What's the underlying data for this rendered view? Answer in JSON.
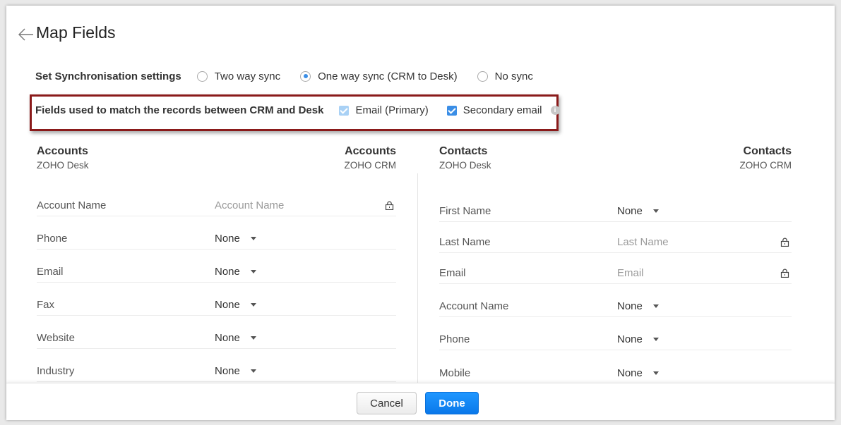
{
  "dialog": {
    "title": "Map Fields"
  },
  "sync": {
    "label": "Set Synchronisation settings",
    "options": [
      {
        "label": "Two way sync",
        "checked": false
      },
      {
        "label": "One way sync (CRM to Desk)",
        "checked": true
      },
      {
        "label": "No sync",
        "checked": false
      }
    ]
  },
  "match": {
    "label": "Fields used to match the records between CRM and Desk",
    "options": [
      {
        "label": "Email (Primary)",
        "checked": true,
        "disabled": true
      },
      {
        "label": "Secondary email",
        "checked": true,
        "disabled": false
      }
    ],
    "info_icon": "i"
  },
  "accounts": {
    "left_title": "Accounts",
    "left_sub": "ZOHO Desk",
    "right_title": "Accounts",
    "right_sub": "ZOHO CRM",
    "rows": [
      {
        "label": "Account Name",
        "value": "Account Name",
        "locked": true
      },
      {
        "label": "Phone",
        "value": "None",
        "locked": false
      },
      {
        "label": "Email",
        "value": "None",
        "locked": false
      },
      {
        "label": "Fax",
        "value": "None",
        "locked": false
      },
      {
        "label": "Website",
        "value": "None",
        "locked": false
      },
      {
        "label": "Industry",
        "value": "None",
        "locked": false
      }
    ]
  },
  "contacts": {
    "left_title": "Contacts",
    "left_sub": "ZOHO Desk",
    "right_title": "Contacts",
    "right_sub": "ZOHO CRM",
    "rows": [
      {
        "label": "First Name",
        "value": "None",
        "locked": false
      },
      {
        "label": "Last Name",
        "value": "Last Name",
        "locked": true
      },
      {
        "label": "Email",
        "value": "Email",
        "locked": true
      },
      {
        "label": "Account Name",
        "value": "None",
        "locked": false
      },
      {
        "label": "Phone",
        "value": "None",
        "locked": false
      },
      {
        "label": "Mobile",
        "value": "None",
        "locked": false
      }
    ]
  },
  "footer": {
    "cancel_label": "Cancel",
    "done_label": "Done"
  },
  "colors": {
    "accent": "#3b8ee6",
    "highlight_border": "#8a1a1a",
    "done_button": "#0a78ea"
  }
}
